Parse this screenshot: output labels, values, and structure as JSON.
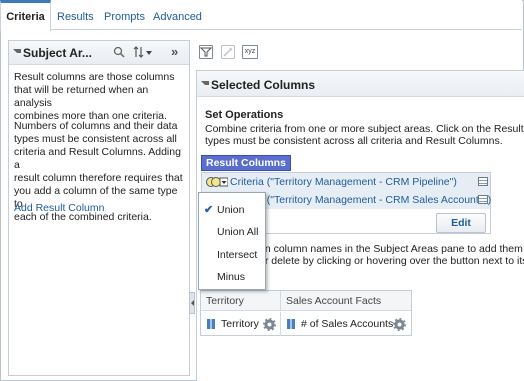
{
  "tabs": [
    "Criteria",
    "Results",
    "Prompts",
    "Advanced"
  ],
  "left_panel": {
    "title": "Subject Ar...",
    "paragraph1": [
      "Result columns are those columns",
      "that will be returned when an analysis",
      "combines more than one criteria."
    ],
    "paragraph2": [
      "Numbers of columns and their data",
      "types must be consistent across all",
      "criteria and Result Columns. Adding a",
      "result column therefore requires that",
      "you add a column of the same type to",
      "each of the combined criteria."
    ],
    "add_link": "Add Result Column"
  },
  "toolbar": {
    "icon3_text": "xyz"
  },
  "selected_columns": {
    "title": "Selected Columns",
    "set_ops_title": "Set Operations",
    "set_ops_desc_line1": "Combine criteria from one or more subject areas. Click on the Result Col",
    "set_ops_desc_line2": "types must be consistent across all criteria and Result Columns.",
    "result_columns_label": "Result Columns",
    "criteria": [
      "Criteria (\"Territory Management - CRM Pipeline\")",
      "Criteria (\"Territory Management - CRM Sales Accounts\")"
    ],
    "edit_label": "Edit",
    "info_line1": "on column names in the Subject Areas pane to add them to t",
    "info_line2": "or delete by clicking or hovering over the button next to its na"
  },
  "dropdown": {
    "items": [
      "Union",
      "Union All",
      "Intersect",
      "Minus"
    ],
    "selected": "Union"
  },
  "table": {
    "headers": [
      "Territory",
      "Sales Account Facts"
    ],
    "cells": [
      "Territory",
      "# of Sales Accounts"
    ]
  },
  "colors": {
    "accent": "#3e79b8",
    "link": "#1f5c99",
    "result_columns_bg": "#5a6ed0"
  }
}
